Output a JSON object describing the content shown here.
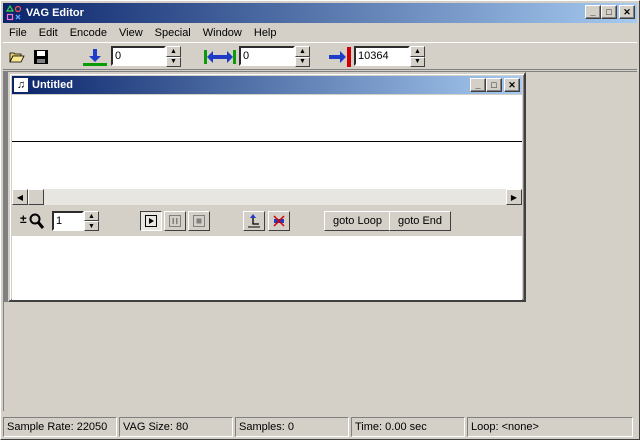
{
  "app": {
    "title": "VAG Editor"
  },
  "window_buttons": {
    "minimize": "_",
    "maximize": "□",
    "close": "✕"
  },
  "menu": [
    "File",
    "Edit",
    "Encode",
    "View",
    "Special",
    "Window",
    "Help"
  ],
  "toolbar": {
    "start_value": "0",
    "loop_value": "0",
    "end_value": "10364"
  },
  "child": {
    "title": "Untitled",
    "zoom_value": "1",
    "goto_loop_label": "goto Loop",
    "goto_end_label": "goto End"
  },
  "status": {
    "sample_rate": "Sample Rate: 22050",
    "vag_size": "VAG Size: 80",
    "samples": "Samples: 0",
    "time": "Time: 0.00 sec",
    "loop": "Loop: <none>"
  },
  "colors": {
    "title_gradient_start": "#0a246a",
    "title_gradient_end": "#a6caf0",
    "start_marker": "#0a9a0a",
    "loop_marker": "#1e3cc8",
    "end_marker": "#d00000"
  }
}
